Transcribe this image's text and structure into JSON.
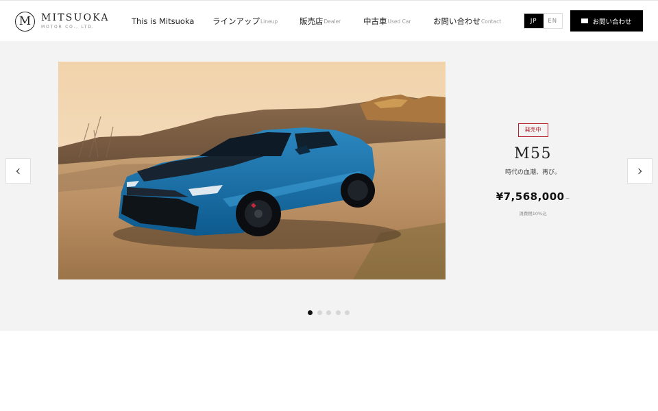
{
  "brand": {
    "mark": "M",
    "name": "MITSUOKA",
    "sub": "MOTOR CO., LTD."
  },
  "nav": [
    {
      "label": "This is Mitsuoka",
      "sub": ""
    },
    {
      "label": "ラインアップ",
      "sub": "Lineup"
    },
    {
      "label": "販売店",
      "sub": "Dealer"
    },
    {
      "label": "中古車",
      "sub": "Used Car"
    },
    {
      "label": "お問い合わせ",
      "sub": "Contact"
    }
  ],
  "language": {
    "options": [
      "JP",
      "EN"
    ],
    "selected": "JP"
  },
  "header_contact": {
    "label": "お問い合わせ",
    "icon": "mail-icon"
  },
  "slider": {
    "status_badge": "発売中",
    "model_name": "M55",
    "tagline": "時代の血潮、再び。",
    "price": "¥7,568,000",
    "price_suffix": "~",
    "tax_note": "消費税10%込",
    "total_slides": 5,
    "active_slide": 1,
    "prev_icon": "chevron-left-icon",
    "next_icon": "chevron-right-icon"
  },
  "colors": {
    "badge_red": "#b3202c",
    "header_bg": "#ffffff",
    "hero_bg": "#f3f3f3",
    "button_black": "#000000"
  }
}
